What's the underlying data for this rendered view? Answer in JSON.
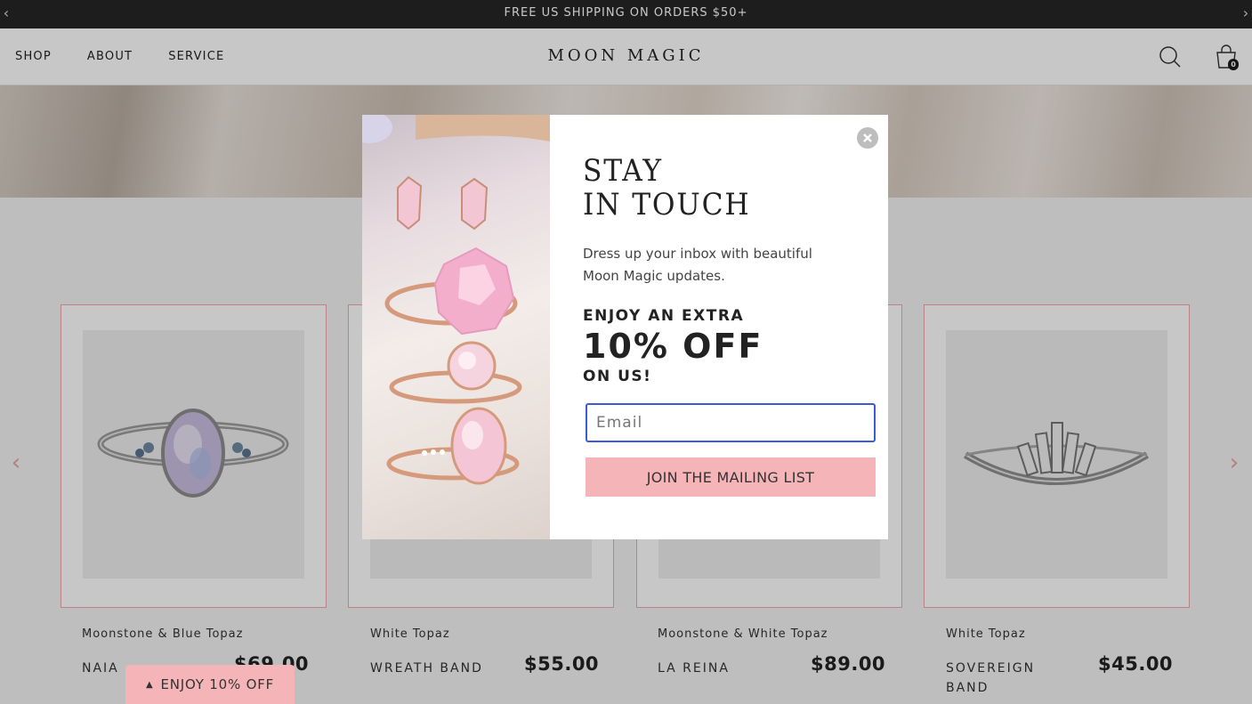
{
  "announcement": {
    "text": "FREE US SHIPPING ON ORDERS $50+",
    "prev_icon": "chevron-left-icon",
    "next_icon": "chevron-right-icon"
  },
  "header": {
    "nav": [
      "SHOP",
      "ABOUT",
      "SERVICE"
    ],
    "logo": "MOON MAGIC",
    "search_icon": "search-icon",
    "cart_icon": "shopping-bag-icon",
    "cart_count": "0"
  },
  "products": [
    {
      "subtitle": "Moonstone & Blue Topaz",
      "name": "NAIA",
      "price": "$69.00"
    },
    {
      "subtitle": "White Topaz",
      "name": "WREATH BAND",
      "price": "$55.00"
    },
    {
      "subtitle": "Moonstone & White Topaz",
      "name": "LA REINA",
      "price": "$89.00"
    },
    {
      "subtitle": "White Topaz",
      "name": "SOVEREIGN BAND",
      "price": "$45.00"
    }
  ],
  "popup": {
    "title_line1": "STAY",
    "title_line2": "IN TOUCH",
    "body": "Dress up your inbox with beautiful Moon Magic updates.",
    "offer_line1": "ENJOY AN EXTRA",
    "offer_line2": "10% OFF",
    "offer_line3": "ON US!",
    "email_placeholder": "Email",
    "email_value": "",
    "button_label": "JOIN THE MAILING LIST",
    "close_icon": "close-icon"
  },
  "promo_tab": {
    "label": "ENJOY 10% OFF",
    "icon": "caret-up-icon"
  },
  "colors": {
    "announcement_bg": "#262626",
    "accent_pink": "#f5b5b8",
    "card_border": "#f0a8ad",
    "input_focus": "#3d5bd9"
  }
}
